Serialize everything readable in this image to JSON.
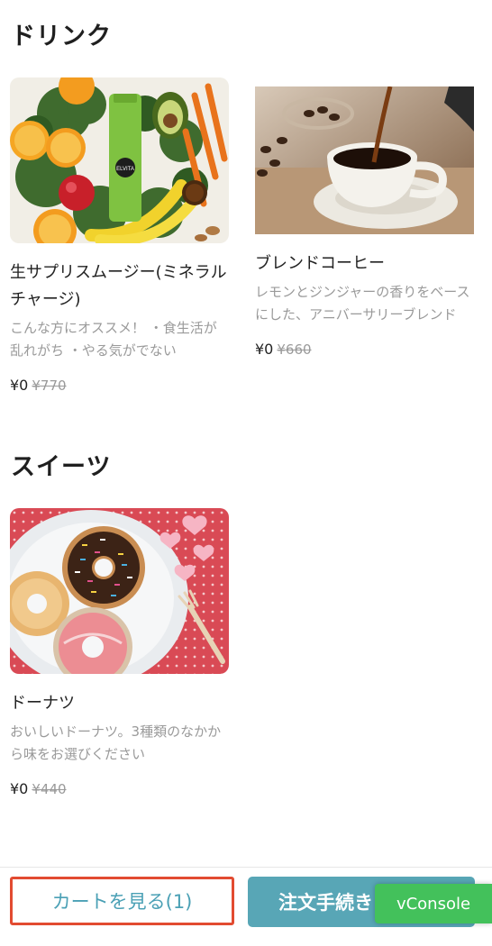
{
  "sections": [
    {
      "title": "ドリンク",
      "items": [
        {
          "name": "生サプリスムージー(ミネラルチャージ)",
          "description": "こんな方にオススメ！ ・食生活が乱れがち ・やる気がでない",
          "price": "¥0",
          "original_price": "¥770",
          "image_alt": "smoothie-image",
          "bottle_label": "ELVITA"
        },
        {
          "name": "ブレンドコーヒー",
          "description": "レモンとジンジャーの香りをベースにした、アニバーサリーブレンド",
          "price": "¥0",
          "original_price": "¥660",
          "image_alt": "coffee-image"
        }
      ]
    },
    {
      "title": "スイーツ",
      "items": [
        {
          "name": "ドーナツ",
          "description": "おいしいドーナツ。3種類のなかから味をお選びください",
          "price": "¥0",
          "original_price": "¥440",
          "image_alt": "donut-image"
        }
      ]
    }
  ],
  "footer": {
    "cart_label": "カートを見る(1)",
    "order_label": "注文手続き",
    "vconsole_label": "vConsole"
  },
  "colors": {
    "accent": "#58a6b6",
    "cart_text": "#4aa0b5",
    "highlight_border": "#e24b31",
    "vconsole": "#43c15b",
    "muted_text": "#9a9a9a"
  }
}
